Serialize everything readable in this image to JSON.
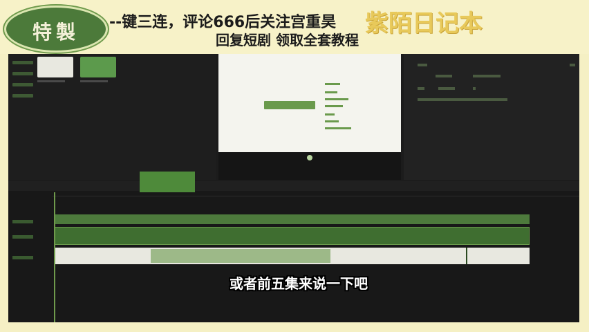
{
  "banner": {
    "badge_text": "特製",
    "promo_line1": "--键三连，评论666后关注宫重昊",
    "brand_text": "紫陌日记本",
    "promo_line2": "回复短剧 领取全套教程"
  },
  "editor": {
    "subtitle_caption": "或者前五集来说一下吧"
  },
  "colors": {
    "accent_green": "#6a9a4c",
    "banner_bg": "#f7f2c8",
    "brand_yellow": "#e8c95a",
    "editor_bg": "#1c1c1c"
  }
}
